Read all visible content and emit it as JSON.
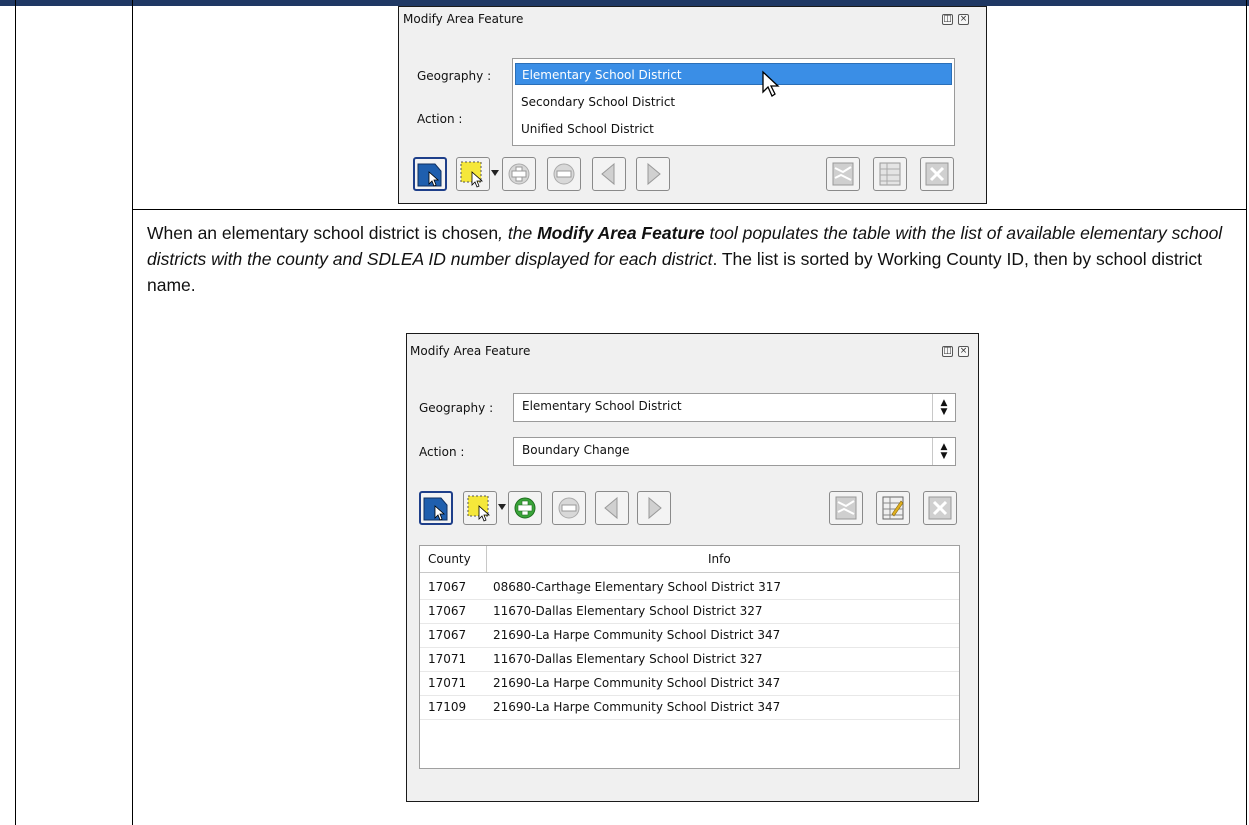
{
  "panel1": {
    "title": "Modify Area Feature",
    "geography_label": "Geography :",
    "action_label": "Action :",
    "options": [
      "Elementary School District",
      "Secondary School District",
      "Unified School District"
    ]
  },
  "paragraph": {
    "p1": "When an elementary school district is chosen",
    "p2": ", the ",
    "p3": "Modify Area Feature",
    "p4": " tool populates the table with the list of available elementary school districts with the county and SDLEA ID number displayed for each district",
    "p5": ". The list is sorted by Working County ID, then by school district name."
  },
  "panel2": {
    "title": "Modify Area Feature",
    "geography_label": "Geography :",
    "geography_value": "Elementary School District",
    "action_label": "Action :",
    "action_value": "Boundary Change",
    "table": {
      "headers": [
        "County",
        "Info"
      ],
      "rows": [
        [
          "17067",
          "08680-Carthage Elementary School District 317"
        ],
        [
          "17067",
          "11670-Dallas Elementary School District 327"
        ],
        [
          "17067",
          "21690-La Harpe Community School District 347"
        ],
        [
          "17071",
          "11670-Dallas Elementary School District 327"
        ],
        [
          "17071",
          "21690-La Harpe Community School District 347"
        ],
        [
          "17109",
          "21690-La Harpe Community School District 347"
        ]
      ]
    }
  },
  "icons": {
    "select_feature": "select-feature-icon",
    "select_area": "select-area-icon",
    "add": "add-icon",
    "remove": "remove-icon",
    "previous": "previous-icon",
    "next": "next-icon",
    "map": "map-icon",
    "table": "table-icon",
    "close": "close-icon"
  }
}
